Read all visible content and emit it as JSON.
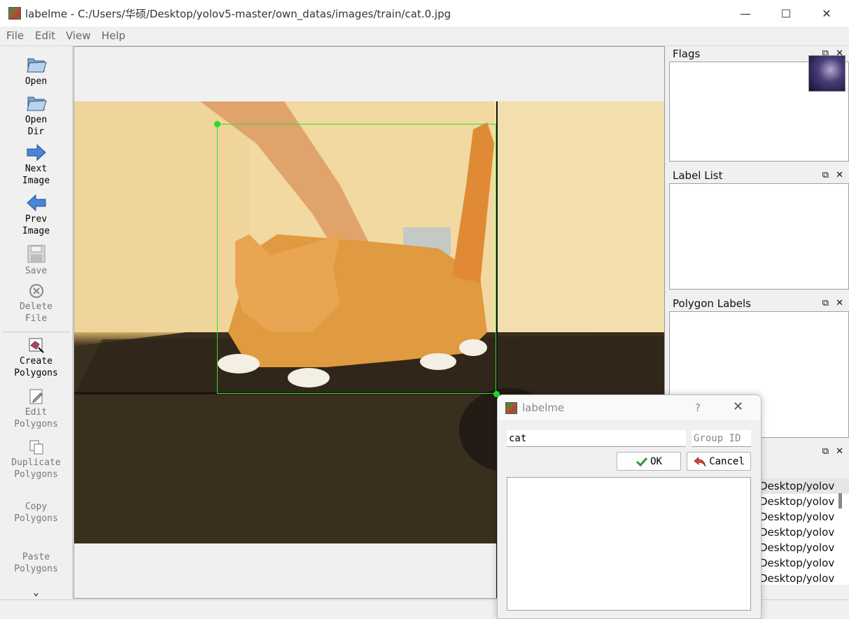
{
  "window": {
    "title": "labelme - C:/Users/华硕/Desktop/yolov5-master/own_datas/images/train/cat.0.jpg",
    "minimize_glyph": "—",
    "maximize_glyph": "☐",
    "close_glyph": "✕"
  },
  "menu": {
    "items": [
      "File",
      "Edit",
      "View",
      "Help"
    ]
  },
  "toolbar": {
    "open": "Open",
    "open_dir_1": "Open",
    "open_dir_2": "Dir",
    "next_1": "Next",
    "next_2": "Image",
    "prev_1": "Prev",
    "prev_2": "Image",
    "save": "Save",
    "delete_1": "Delete",
    "delete_2": "File",
    "create_1": "Create",
    "create_2": "Polygons",
    "edit_1": "Edit",
    "edit_2": "Polygons",
    "duplicate_1": "Duplicate",
    "duplicate_2": "Polygons",
    "copy_1": "Copy",
    "copy_2": "Polygons",
    "paste_1": "Paste",
    "paste_2": "Polygons",
    "more_glyph": "⌄"
  },
  "docks": {
    "flags": {
      "title": "Flags"
    },
    "label_list": {
      "title": "Label List"
    },
    "polygon_labels": {
      "title": "Polygon Labels"
    },
    "float_glyph": "⧉",
    "close_glyph": "✕"
  },
  "file_list": {
    "items": [
      "Desktop/yolov",
      "Desktop/yolov",
      "Desktop/yolov",
      "Desktop/yolov",
      "Desktop/yolov",
      "Desktop/yolov",
      "Desktop/yolov"
    ]
  },
  "dialog": {
    "title": "labelme",
    "help_glyph": "?",
    "close_glyph": "✕",
    "label_value": "cat",
    "group_id_placeholder": "Group ID",
    "ok_label": "OK",
    "cancel_label": "Cancel"
  },
  "colors": {
    "bbox": "#33dd33",
    "crosshair": "#111111"
  }
}
